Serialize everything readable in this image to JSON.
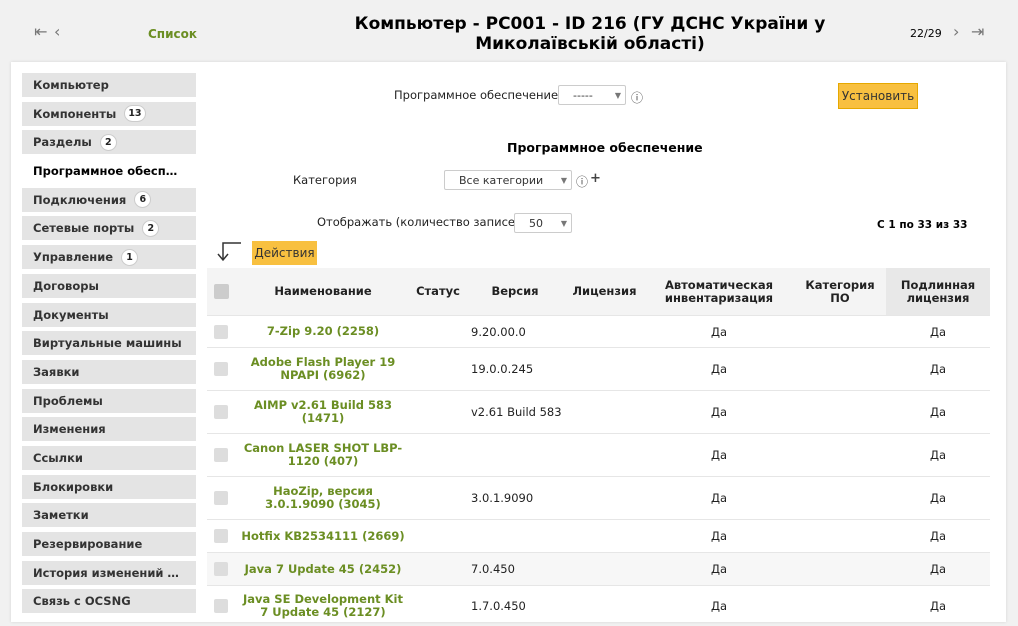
{
  "header": {
    "nav_first": "⇤",
    "nav_prev": "‹",
    "list_link": "Список",
    "title": "Компьютер - PC001 - ID 216 (ГУ ДСНС України у Миколаївській області)",
    "pager": "22/29",
    "nav_next": "›",
    "nav_last": "⇥"
  },
  "sidebar": {
    "items": [
      {
        "label": "Компьютер",
        "badge": ""
      },
      {
        "label": "Компоненты",
        "badge": "13"
      },
      {
        "label": "Разделы",
        "badge": "2"
      },
      {
        "label": "Программное обесп…",
        "badge": "",
        "active": true
      },
      {
        "label": "Подключения",
        "badge": "6"
      },
      {
        "label": "Сетевые порты",
        "badge": "2"
      },
      {
        "label": "Управление",
        "badge": "1"
      },
      {
        "label": "Договоры",
        "badge": ""
      },
      {
        "label": "Документы",
        "badge": ""
      },
      {
        "label": "Виртуальные машины",
        "badge": ""
      },
      {
        "label": "Заявки",
        "badge": ""
      },
      {
        "label": "Проблемы",
        "badge": ""
      },
      {
        "label": "Изменения",
        "badge": ""
      },
      {
        "label": "Ссылки",
        "badge": ""
      },
      {
        "label": "Блокировки",
        "badge": ""
      },
      {
        "label": "Заметки",
        "badge": ""
      },
      {
        "label": "Резервирование",
        "badge": ""
      },
      {
        "label": "История изменений …",
        "badge": ""
      },
      {
        "label": "Связь с OCSNG",
        "badge": ""
      }
    ]
  },
  "install_form": {
    "software_label": "Программное обеспечение",
    "software_value": "-----",
    "install_button": "Установить"
  },
  "software_section": {
    "title": "Программное обеспечение",
    "category_label": "Категория",
    "category_value": "Все категории",
    "show_label": "Отображать (количество записей)",
    "show_value": "50",
    "records_info": "С 1 по 33 из 33",
    "actions_button": "Действия"
  },
  "table": {
    "columns": [
      "Наименование",
      "Статус",
      "Версия",
      "Лицензия",
      "Автоматическая инвентаризация",
      "Категория ПО",
      "Подлинная лицензия"
    ],
    "rows": [
      {
        "name": "7-Zip 9.20 (2258)",
        "status": "",
        "version": "9.20.00.0",
        "license": "",
        "auto": "Да",
        "category": "",
        "genuine": "Да"
      },
      {
        "name": "Adobe Flash Player 19 NPAPI (6962)",
        "status": "",
        "version": "19.0.0.245",
        "license": "",
        "auto": "Да",
        "category": "",
        "genuine": "Да"
      },
      {
        "name": "AIMP v2.61 Build 583 (1471)",
        "status": "",
        "version": "v2.61 Build 583",
        "license": "",
        "auto": "Да",
        "category": "",
        "genuine": "Да"
      },
      {
        "name": "Canon LASER SHOT LBP-1120 (407)",
        "status": "",
        "version": "",
        "license": "",
        "auto": "Да",
        "category": "",
        "genuine": "Да"
      },
      {
        "name": "HaoZip, версия 3.0.1.9090 (3045)",
        "status": "",
        "version": "3.0.1.9090",
        "license": "",
        "auto": "Да",
        "category": "",
        "genuine": "Да"
      },
      {
        "name": "Hotfix KB2534111 (2669)",
        "status": "",
        "version": "",
        "license": "",
        "auto": "Да",
        "category": "",
        "genuine": "Да"
      },
      {
        "name": "Java 7 Update 45 (2452)",
        "status": "",
        "version": "7.0.450",
        "license": "",
        "auto": "Да",
        "category": "",
        "genuine": "Да"
      },
      {
        "name": "Java SE Development Kit 7 Update 45 (2127)",
        "status": "",
        "version": "1.7.0.450",
        "license": "",
        "auto": "Да",
        "category": "",
        "genuine": "Да"
      }
    ]
  }
}
